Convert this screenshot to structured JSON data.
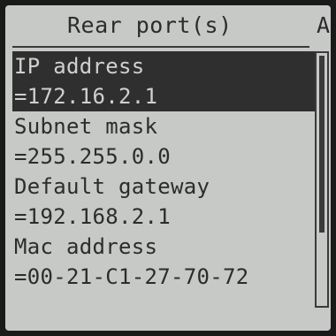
{
  "header": {
    "title": "Rear port(s)",
    "tab_label": "A"
  },
  "items": [
    {
      "label": "IP address"
    },
    {
      "label": "=172.16.2.1"
    },
    {
      "label": "Subnet mask"
    },
    {
      "label": "=255.255.0.0"
    },
    {
      "label": "Default gateway"
    },
    {
      "label": "=192.168.2.1"
    },
    {
      "label": "Mac address"
    },
    {
      "label": "=00-21-C1-27-70-72"
    }
  ],
  "selected_rows": [
    0,
    1
  ],
  "colors": {
    "screen_bg": "#c7c9c6",
    "text": "#2c2c2c",
    "selection_bg": "#2f2f2f",
    "selection_text": "#cfd1ce"
  }
}
